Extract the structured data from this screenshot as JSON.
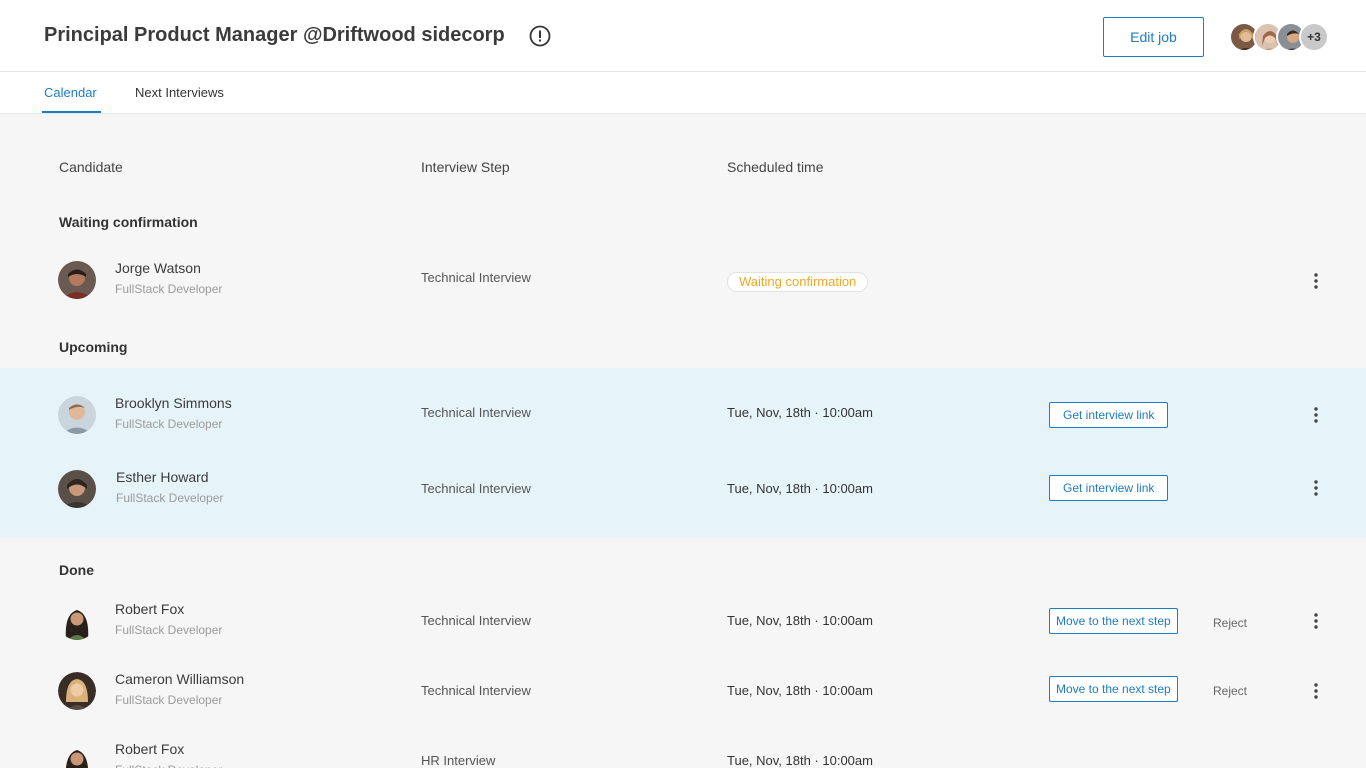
{
  "header": {
    "title": "Principal Product Manager @Driftwood sidecorp",
    "edit_label": "Edit job",
    "team_more": "+3"
  },
  "tabs": [
    {
      "label": "Calendar",
      "active": true
    },
    {
      "label": "Next Interviews",
      "active": false
    }
  ],
  "columns": {
    "candidate": "Candidate",
    "step": "Interview Step",
    "time": "Scheduled time"
  },
  "sections": {
    "waiting": "Waiting confirmation",
    "upcoming": "Upcoming",
    "done": "Done"
  },
  "waiting_rows": [
    {
      "name": "Jorge Watson",
      "role": "FullStack Developer",
      "step": "Technical Interview",
      "status": "Waiting confirmation"
    }
  ],
  "upcoming_rows": [
    {
      "name": "Brooklyn Simmons",
      "role": "FullStack Developer",
      "step": "Technical Interview",
      "time": "Tue, Nov, 18th · 10:00am",
      "action": "Get interview link"
    },
    {
      "name": "Esther Howard",
      "role": "FullStack Developer",
      "step": "Technical Interview",
      "time": "Tue, Nov, 18th · 10:00am",
      "action": "Get interview link"
    }
  ],
  "done_rows": [
    {
      "name": "Robert Fox",
      "role": "FullStack Developer",
      "step": "Technical Interview",
      "time": "Tue, Nov, 18th · 10:00am",
      "action": "Move to the next step",
      "reject": "Reject"
    },
    {
      "name": "Cameron Williamson",
      "role": "FullStack Developer",
      "step": "Technical Interview",
      "time": "Tue, Nov, 18th · 10:00am",
      "action": "Move to the next step",
      "reject": "Reject"
    },
    {
      "name": "Robert Fox",
      "role": "FullStack Developer",
      "step": "HR Interview",
      "time": "Tue, Nov, 18th · 10:00am"
    }
  ],
  "colors": {
    "accent": "#1d7cc2",
    "pending": "#f2a627",
    "highlight": "#e6f4fa"
  }
}
